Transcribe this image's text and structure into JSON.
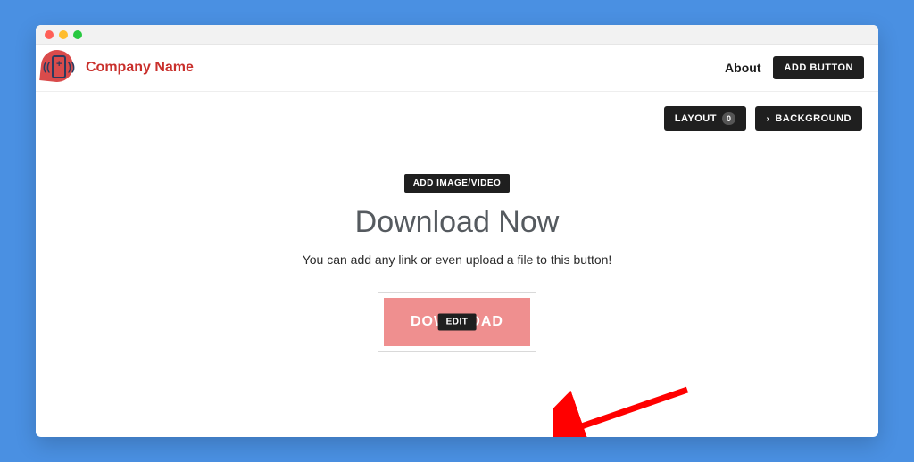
{
  "header": {
    "company_name": "Company Name",
    "about_label": "About",
    "add_button_label": "ADD BUTTON"
  },
  "toolbar": {
    "layout_label": "LAYOUT",
    "layout_count": "0",
    "background_label": "BACKGROUND"
  },
  "content": {
    "add_media_label": "ADD IMAGE/VIDEO",
    "heading": "Download Now",
    "subtitle": "You can add any link or even upload a file to this button!",
    "download_label": "DOWNLOAD",
    "edit_label": "EDIT"
  },
  "colors": {
    "accent_red": "#c9302c",
    "button_pink": "#ef8f8f",
    "dark": "#1f1f1f",
    "arrow": "#ff0000"
  }
}
